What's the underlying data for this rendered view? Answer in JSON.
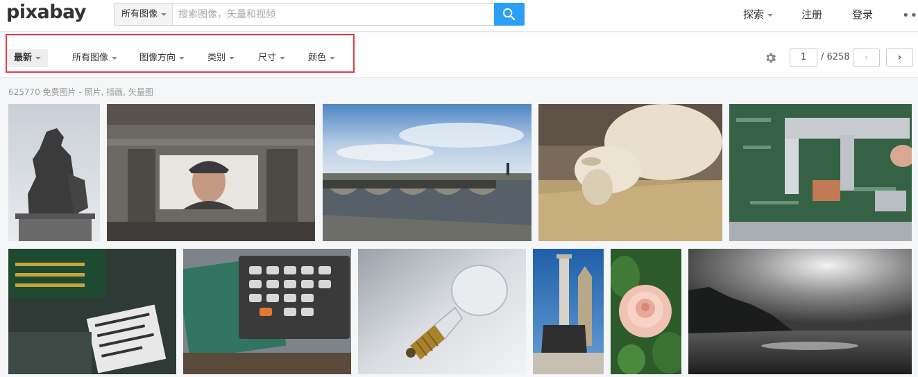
{
  "header": {
    "logo": "pixabay",
    "search": {
      "type_label": "所有图像",
      "placeholder": "搜索图像，矢量和视频"
    },
    "nav": {
      "explore": "探索",
      "register": "注册",
      "login": "登录",
      "more": "•••"
    }
  },
  "filters": {
    "items": [
      {
        "label": "最新",
        "active": true
      },
      {
        "label": "所有图像",
        "active": false
      },
      {
        "label": "图像方向",
        "active": false
      },
      {
        "label": "类别",
        "active": false
      },
      {
        "label": "尺寸",
        "active": false
      },
      {
        "label": "颜色",
        "active": false
      }
    ]
  },
  "pagination": {
    "current": "1",
    "total": "/ 6258",
    "prev": "‹",
    "next": "›"
  },
  "results_text": "625770 免费图片 - 照片, 插画, 矢量图",
  "images": [
    {
      "subject": "statue"
    },
    {
      "subject": "building-portrait-mural"
    },
    {
      "subject": "river-bridge"
    },
    {
      "subject": "sheep-grazing"
    },
    {
      "subject": "caliper-circuit-board"
    },
    {
      "subject": "laptop-internals"
    },
    {
      "subject": "calculator-circuit"
    },
    {
      "subject": "light-bulb"
    },
    {
      "subject": "column-monument"
    },
    {
      "subject": "pink-rose"
    },
    {
      "subject": "sea-cliffs-clouds"
    }
  ],
  "colors": {
    "accent": "#2a9ff5",
    "highlight_border": "#e63946"
  }
}
